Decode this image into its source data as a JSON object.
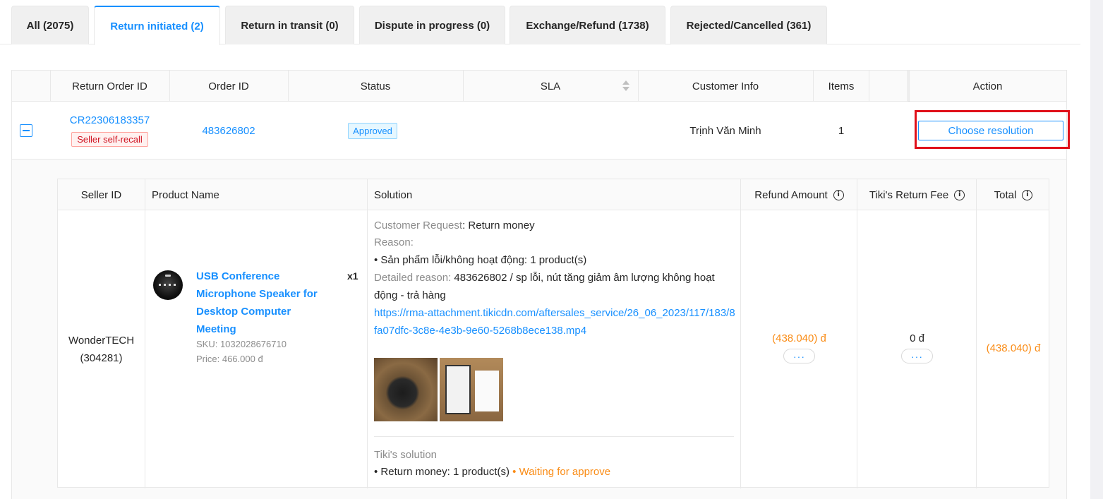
{
  "tabs": [
    {
      "label": "All (2075)"
    },
    {
      "label": "Return initiated (2)"
    },
    {
      "label": "Return in transit (0)"
    },
    {
      "label": "Dispute in progress (0)"
    },
    {
      "label": "Exchange/Refund (1738)"
    },
    {
      "label": "Rejected/Cancelled (361)"
    }
  ],
  "active_tab": "Return initiated (2)",
  "table": {
    "headers": {
      "return_order_id": "Return Order ID",
      "order_id": "Order ID",
      "status": "Status",
      "sla": "SLA",
      "customer_info": "Customer Info",
      "items": "Items",
      "action": "Action"
    },
    "row": {
      "return_order_id": "CR22306183357",
      "recall_tag": "Seller self-recall",
      "order_id": "483626802",
      "status": "Approved",
      "sla": "",
      "customer": "Trịnh Văn Minh",
      "items": "1",
      "action_button": "Choose resolution"
    }
  },
  "detail": {
    "headers": {
      "seller_id": "Seller ID",
      "product_name": "Product Name",
      "solution": "Solution",
      "refund_amount": "Refund Amount",
      "return_fee": "Tiki's Return Fee",
      "total": "Total"
    },
    "seller_name": "WonderTECH",
    "seller_id": "(304281)",
    "product": {
      "name": "USB Conference Microphone Speaker for Desktop Computer Meeting",
      "sku": "SKU: 1032028676710",
      "price": "Price: 466.000 đ",
      "qty": "x1"
    },
    "solution": {
      "customer_request_label": "Customer Request",
      "customer_request_value": ": Return money",
      "reason_label": "Reason:",
      "reason_item": "• Sản phẩm lỗi/không hoạt động: 1 product(s)",
      "detailed_reason_label": "Detailed reason: ",
      "detailed_reason_line1": "483626802 / sp lỗi, nút tăng giảm âm lượng không hoạt",
      "detailed_reason_line2": "động - trả hàng",
      "attachment_link": "https://rma-attachment.tikicdn.com/aftersales_service/26_06_2023/117/183/8fa07dfc-3c8e-4e3b-9e60-5268b8ece138.mp4",
      "tiki_solution_label": "Tiki's solution",
      "tiki_solution_item": "• Return money: 1 product(s)",
      "tiki_solution_status": " • Waiting for approve"
    },
    "refund_amount": "(438.040) đ",
    "return_fee": "0 đ",
    "total": "(438.040) đ",
    "more_label": "···"
  },
  "colors": {
    "accent": "#1890ff",
    "warning": "#fa8c16",
    "danger": "#cf1322",
    "highlight": "#e0101a"
  }
}
